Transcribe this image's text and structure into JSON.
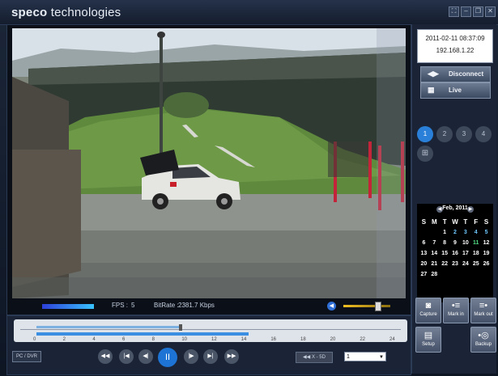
{
  "app": {
    "brand_bold": "speco",
    "brand_light": "technologies"
  },
  "window_controls": [
    {
      "name": "fullscreen",
      "glyph": "⛶"
    },
    {
      "name": "minimize",
      "glyph": "–"
    },
    {
      "name": "restore",
      "glyph": "❐"
    },
    {
      "name": "close",
      "glyph": "✕"
    }
  ],
  "info": {
    "datetime": "2011-02-11 08:37:09",
    "ip": "192.168.1.22"
  },
  "buttons": {
    "disconnect": "Disconnect",
    "live": "Live",
    "capture": "Capture",
    "mark_in": "Mark in",
    "mark_out": "Mark out",
    "setup": "Setup",
    "backup": "Backup",
    "pc_dvr": "PC / DVR",
    "speed": "◀◀ X - 5D"
  },
  "channels": [
    "1",
    "2",
    "3",
    "4"
  ],
  "active_channel": "1",
  "status": {
    "fps_label": "FPS :",
    "fps_value": "5",
    "bitrate_label": "BitRate :",
    "bitrate_value": "2381.7 Kbps"
  },
  "calendar": {
    "month": "Feb, 2011",
    "weekdays": [
      "S",
      "M",
      "T",
      "W",
      "T",
      "F",
      "S"
    ],
    "weeks": [
      [
        "",
        "",
        "1",
        "2",
        "3",
        "4",
        "5"
      ],
      [
        "6",
        "7",
        "8",
        "9",
        "10",
        "11",
        "12"
      ],
      [
        "13",
        "14",
        "15",
        "16",
        "17",
        "18",
        "19"
      ],
      [
        "20",
        "21",
        "22",
        "23",
        "24",
        "25",
        "26"
      ],
      [
        "27",
        "28",
        "",
        "",
        "",
        "",
        ""
      ]
    ],
    "today": "11"
  },
  "timeline": {
    "ticks": [
      "0",
      "2",
      "4",
      "6",
      "8",
      "10",
      "12",
      "14",
      "16",
      "18",
      "20",
      "22",
      "24"
    ]
  },
  "playback": [
    "◀◀",
    "|◀",
    "◀|",
    "II",
    "|▶",
    "▶|",
    "▶▶"
  ],
  "channel_select": {
    "value": "1"
  },
  "colors": {
    "accent": "#2a80d8",
    "play": "#1e74d4"
  }
}
